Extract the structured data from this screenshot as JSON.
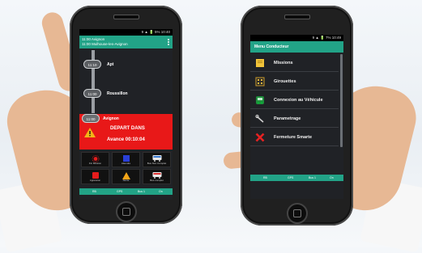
{
  "left_phone": {
    "status": "9 ▲ 🔋 5% 10:40",
    "header": {
      "line1": "11:00 Avignon",
      "line2": "11:00 Mulhouse-les-Avignon"
    },
    "stops": [
      {
        "time": "11:10",
        "name": "Apt"
      },
      {
        "time": "11:00",
        "name": "Roussillon"
      },
      {
        "time": "11:00",
        "name": "Avignon"
      }
    ],
    "alert": {
      "title": "DEPART DANS",
      "subtitle": "Avance 00:10:04",
      "color": "#e81818"
    },
    "buttons": [
      {
        "label": "Fin Mission",
        "icon": "sun-icon"
      },
      {
        "label": "Attendre",
        "icon": "stop-icon"
      },
      {
        "label": "Bus Non Complet",
        "icon": "bus-icon"
      },
      {
        "label": "Agression",
        "icon": "alarm-icon"
      },
      {
        "label": "Alerte",
        "icon": "warning-icon"
      },
      {
        "label": "Bus complet",
        "icon": "bus-icon"
      }
    ],
    "bottom": {
      "left": "RB",
      "mid": "GPS",
      "right1": "Bus 1",
      "right2": "On"
    }
  },
  "right_phone": {
    "status": "9 ▲ 🔋 7% 10:49",
    "title": "Menu Conducteur",
    "items": [
      {
        "label": "Missions",
        "icon": "folder-icon"
      },
      {
        "label": "Girouettes",
        "icon": "sign-icon"
      },
      {
        "label": "Connexion au Véhicule",
        "icon": "bus-icon"
      },
      {
        "label": "Parametrage",
        "icon": "tools-icon"
      },
      {
        "label": "Fermeture Smarte",
        "icon": "close-icon"
      }
    ],
    "bottom": {
      "left": "RB",
      "mid": "GPS",
      "right1": "Bus 1",
      "right2": "On"
    }
  },
  "colors": {
    "accent": "#22a387",
    "alert": "#e81818",
    "screen": "#202226"
  }
}
